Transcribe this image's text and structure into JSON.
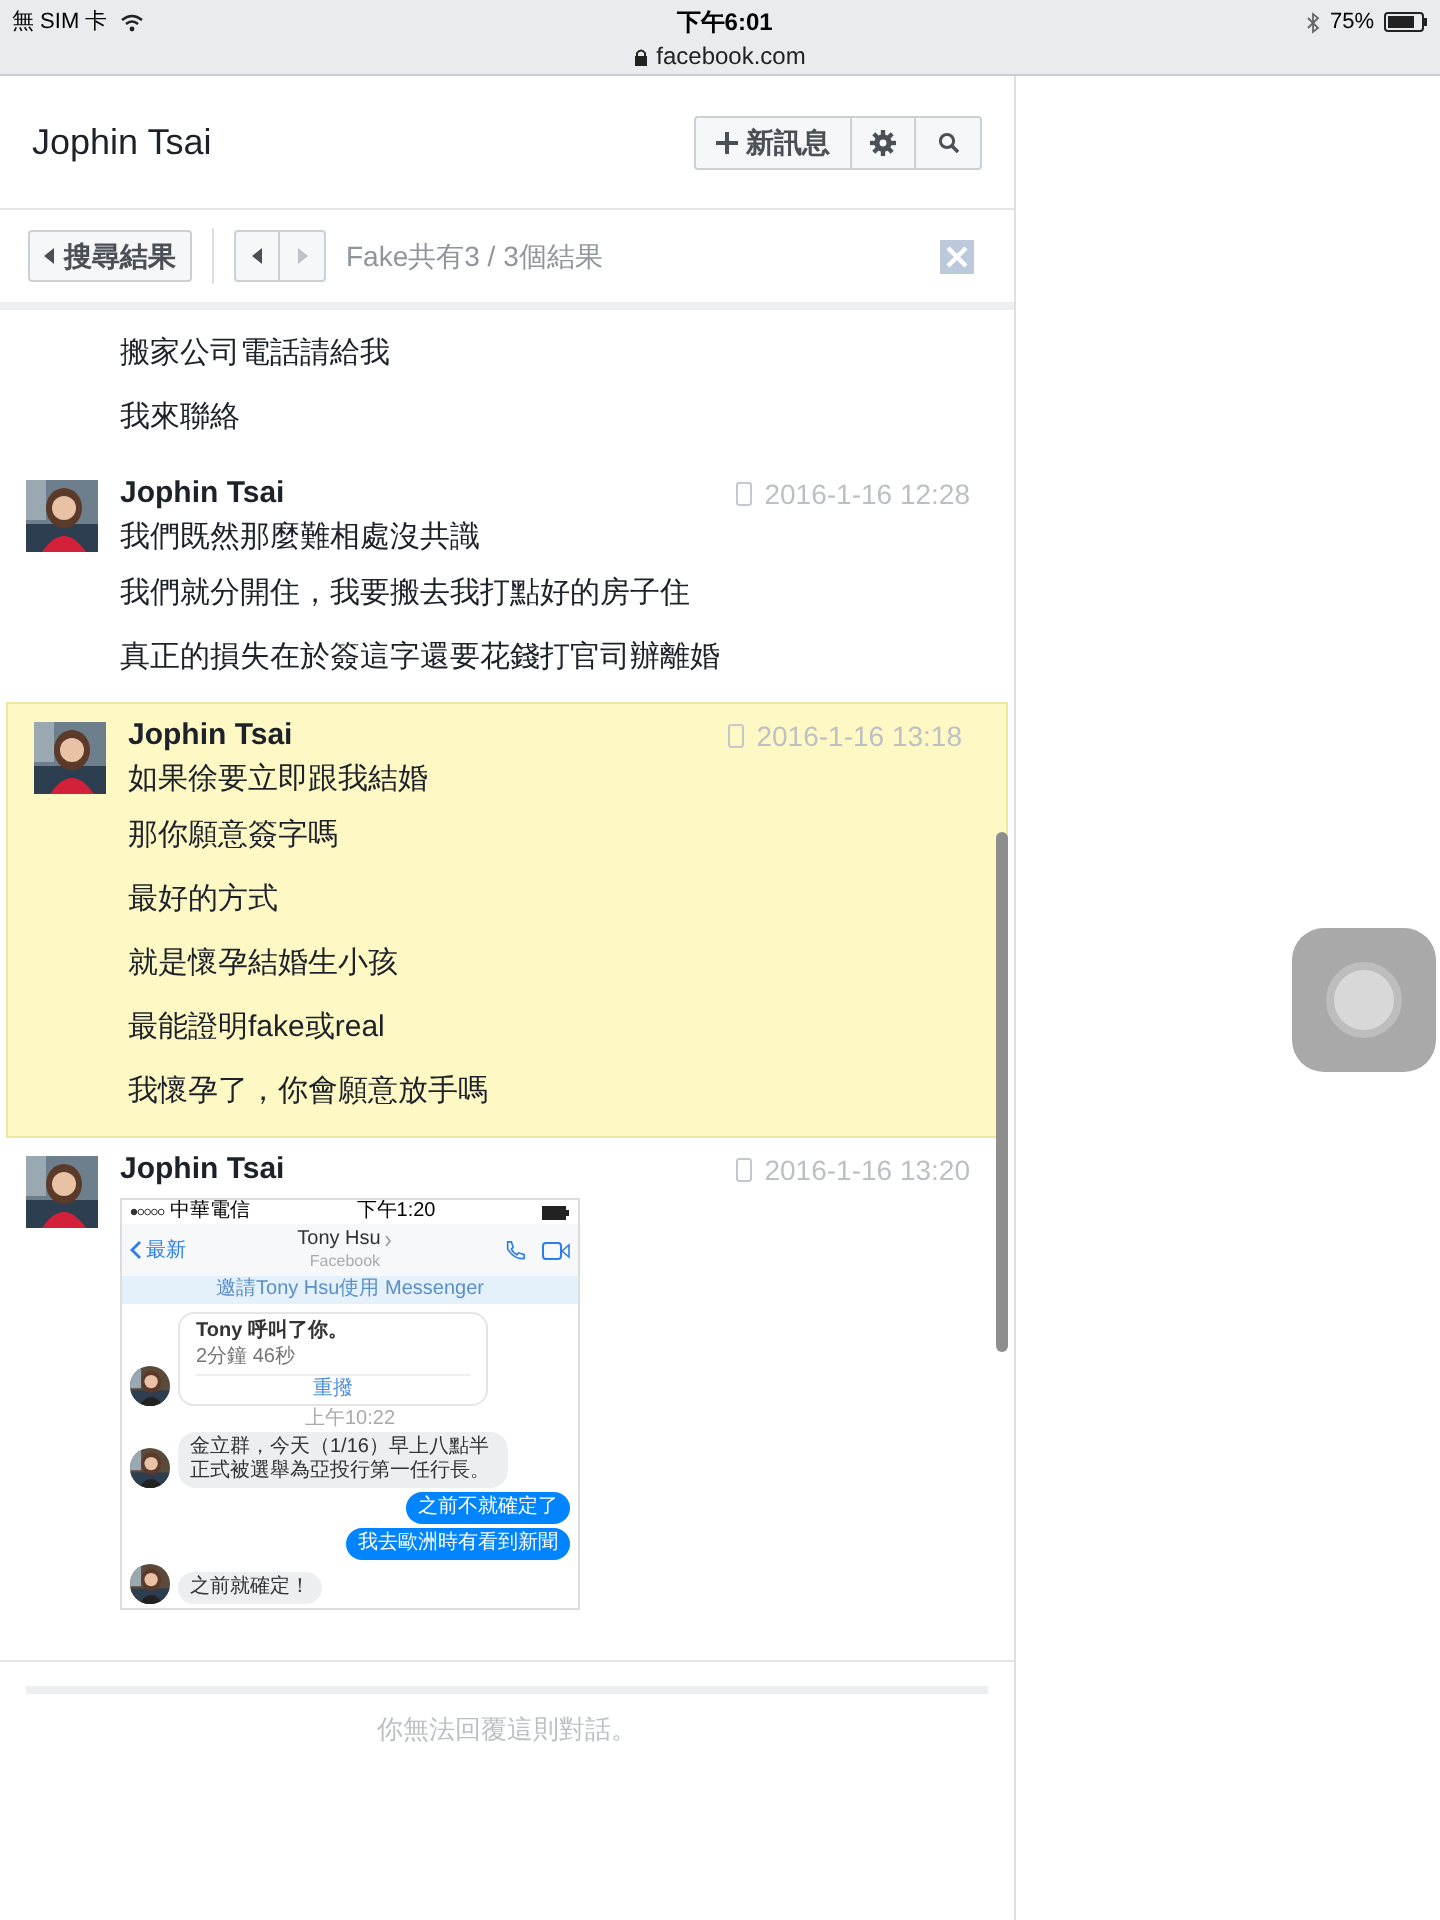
{
  "status_bar": {
    "carrier": "無 SIM 卡",
    "time": "下午6:01",
    "url": "facebook.com",
    "battery": "75%"
  },
  "header": {
    "title": "Jophin Tsai",
    "new_message_button": "新訊息"
  },
  "search_bar": {
    "back_button": "搜尋結果",
    "result_text": "Fake共有3 / 3個結果"
  },
  "messages": [
    {
      "kind": "text",
      "highlighted": false,
      "lines": [
        "搬家公司電話請給我",
        "我來聯絡"
      ]
    },
    {
      "kind": "text",
      "highlighted": false,
      "sender": "Jophin Tsai",
      "time": "2016-1-16 12:28",
      "lines": [
        "我們既然那麼難相處沒共識",
        "我們就分開住，我要搬去我打點好的房子住",
        "真正的損失在於簽這字還要花錢打官司辦離婚"
      ]
    },
    {
      "kind": "text",
      "highlighted": true,
      "sender": "Jophin Tsai",
      "time": "2016-1-16 13:18",
      "lines": [
        "如果徐要立即跟我結婚",
        "那你願意簽字嗎",
        "最好的方式",
        "就是懷孕結婚生小孩",
        "最能證明fake或real",
        "我懷孕了，你會願意放手嗎"
      ]
    },
    {
      "kind": "screenshot",
      "highlighted": false,
      "sender": "Jophin Tsai",
      "time": "2016-1-16 13:20",
      "screenshot": {
        "carrier": "中華電信",
        "time": "下午1:20",
        "back": "最新",
        "contact": "Tony Hsu",
        "subtitle": "Facebook",
        "banner": "邀請Tony Hsu使用 Messenger",
        "call_card": {
          "title": "Tony 呼叫了你。",
          "duration": "2分鐘 46秒",
          "action": "重撥"
        },
        "timestamp": "上午10:22",
        "bubbles": [
          {
            "kind": "received",
            "text": "金立群，今天（1/16）早上八點半正式被選舉為亞投行第一任行長。"
          },
          {
            "kind": "sent",
            "text": "之前不就確定了"
          },
          {
            "kind": "sent",
            "text": "我去歐洲時有看到新聞"
          },
          {
            "kind": "received",
            "text": "之前就確定！"
          }
        ]
      }
    }
  ],
  "footer": {
    "notice": "你無法回覆這則對話。"
  }
}
